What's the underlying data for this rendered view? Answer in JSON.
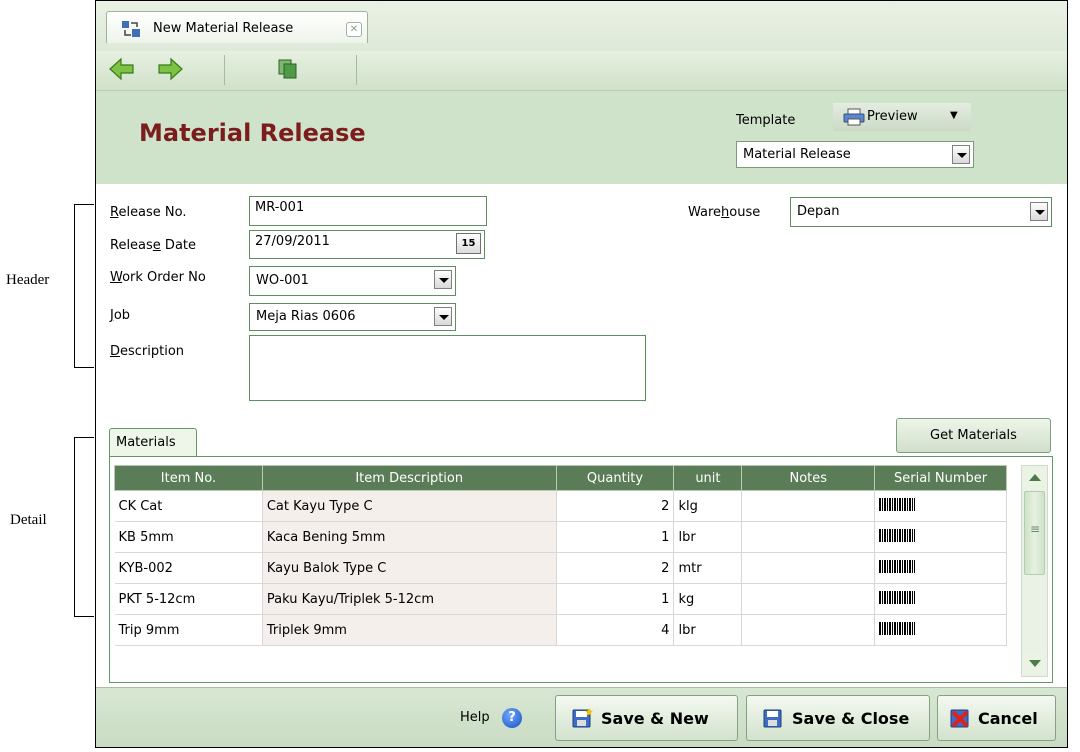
{
  "annotations": {
    "header_label": "Header",
    "detail_label": "Detail"
  },
  "tab": {
    "title": "New Material Release",
    "close_icon": "close-icon"
  },
  "toolbar": {
    "back_icon": "arrow-left-icon",
    "forward_icon": "arrow-right-icon",
    "copy_icon": "copy-icon"
  },
  "banner": {
    "title": "Material Release",
    "template_label": "Template",
    "preview_label": "Preview",
    "template_value": "Material Release"
  },
  "form": {
    "release_no_label_pre": "",
    "release_no_label_ul": "R",
    "release_no_label_post": "elease No.",
    "release_no": "MR-001",
    "release_date_label_pre": "Releas",
    "release_date_label_ul": "e",
    "release_date_label_post": " Date",
    "release_date": "27/09/2011",
    "calendar_day": "15",
    "work_order_label_pre": "",
    "work_order_label_ul": "W",
    "work_order_label_post": "ork Order No",
    "work_order": "WO-001",
    "job_label_pre": "",
    "job_label_ul": "J",
    "job_label_post": "ob",
    "job": "Meja Rias 0606",
    "description_label_pre": "",
    "description_label_ul": "D",
    "description_label_post": "escription",
    "description": "",
    "warehouse_label_pre": "Ware",
    "warehouse_label_ul": "h",
    "warehouse_label_post": "ouse",
    "warehouse": "Depan"
  },
  "detail": {
    "tab_label": "Materials",
    "get_materials_label": "Get Materials",
    "columns": [
      "Item No.",
      "Item Description",
      "Quantity",
      "unit",
      "Notes",
      "Serial Number"
    ],
    "rows": [
      {
        "item_no": "CK Cat",
        "description": "Cat Kayu Type C",
        "quantity": "2",
        "unit": "klg",
        "notes": ""
      },
      {
        "item_no": "KB 5mm",
        "description": "Kaca Bening 5mm",
        "quantity": "1",
        "unit": "lbr",
        "notes": ""
      },
      {
        "item_no": "KYB-002",
        "description": "Kayu Balok Type C",
        "quantity": "2",
        "unit": "mtr",
        "notes": ""
      },
      {
        "item_no": "PKT 5-12cm",
        "description": "Paku Kayu/Triplek 5-12cm",
        "quantity": "1",
        "unit": "kg",
        "notes": ""
      },
      {
        "item_no": "Trip 9mm",
        "description": "Triplek 9mm",
        "quantity": "4",
        "unit": "lbr",
        "notes": ""
      }
    ]
  },
  "footer": {
    "help_label": "Help",
    "help_icon": "?",
    "save_new_label": "Save & New",
    "save_close_label": "Save & Close",
    "cancel_label": "Cancel"
  },
  "colors": {
    "title_color": "#7b1d1d",
    "header_bg": "#5a7d57",
    "banner_bg": "#cfe2ca"
  }
}
